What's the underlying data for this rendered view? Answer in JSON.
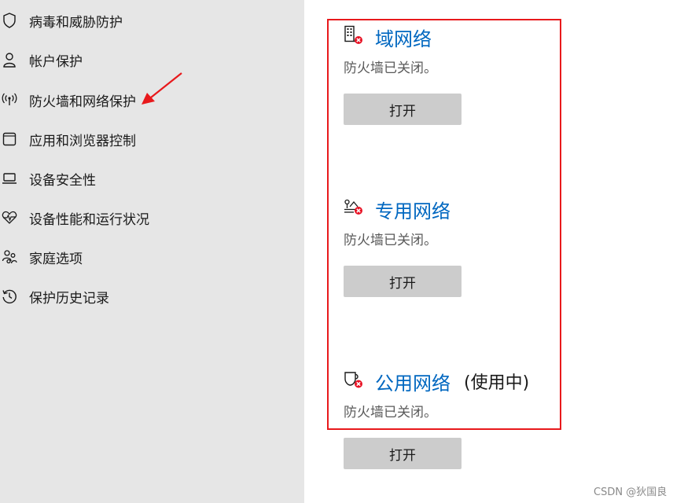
{
  "sidebar": {
    "items": [
      {
        "label": "病毒和威胁防护",
        "icon": "shield-icon"
      },
      {
        "label": "帐户保护",
        "icon": "person-icon"
      },
      {
        "label": "防火墙和网络保护",
        "icon": "antenna-icon"
      },
      {
        "label": "应用和浏览器控制",
        "icon": "app-window-icon"
      },
      {
        "label": "设备安全性",
        "icon": "laptop-icon"
      },
      {
        "label": "设备性能和运行状况",
        "icon": "heart-pulse-icon"
      },
      {
        "label": "家庭选项",
        "icon": "family-icon"
      },
      {
        "label": "保护历史记录",
        "icon": "history-icon"
      }
    ]
  },
  "networks": [
    {
      "title": "域网络",
      "suffix": "",
      "status": "防火墙已关闭。",
      "button_label": "打开",
      "icon": "domain-network-icon"
    },
    {
      "title": "专用网络",
      "suffix": "",
      "status": "防火墙已关闭。",
      "button_label": "打开",
      "icon": "private-network-icon"
    },
    {
      "title": "公用网络",
      "suffix": "(使用中)",
      "status": "防火墙已关闭。",
      "button_label": "打开",
      "icon": "public-network-icon"
    }
  ],
  "watermark": "CSDN @狄国良",
  "colors": {
    "accent": "#0067c0",
    "sidebar_bg": "#e6e6e6",
    "button_bg": "#cccccc",
    "highlight": "#e8191c",
    "status_error": "#e81123"
  }
}
